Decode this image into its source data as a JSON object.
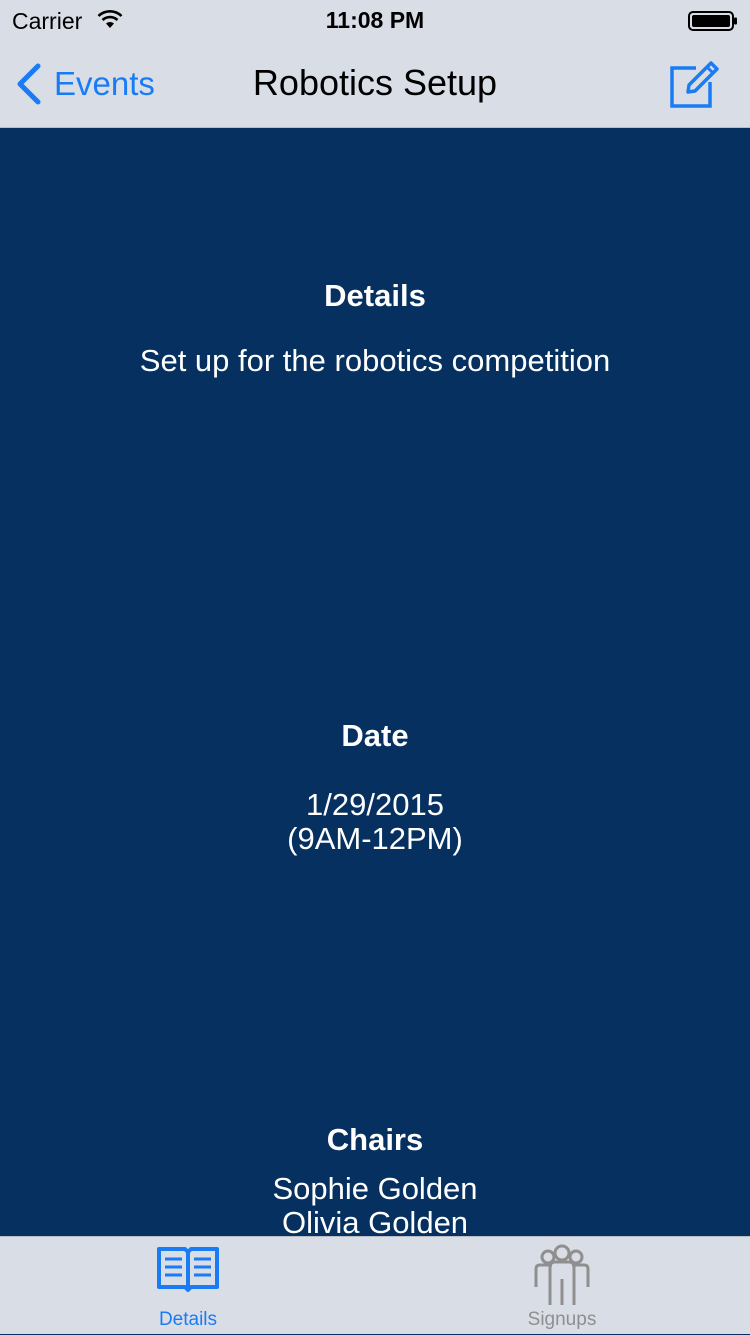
{
  "status_bar": {
    "carrier": "Carrier",
    "time": "11:08 PM"
  },
  "nav_bar": {
    "back_label": "Events",
    "title": "Robotics Setup",
    "accent_color": "#1a7cf5",
    "right_icon": "compose-icon"
  },
  "details": {
    "heading": "Details",
    "text": "Set up for the robotics competition"
  },
  "date": {
    "heading": "Date",
    "line1": "1/29/2015",
    "line2": "(9AM-12PM)"
  },
  "chairs": {
    "heading": "Chairs",
    "names": [
      "Sophie Golden",
      "Olivia Golden"
    ]
  },
  "tab_bar": {
    "tabs": [
      {
        "label": "Details",
        "icon": "book-icon",
        "selected": true
      },
      {
        "label": "Signups",
        "icon": "people-icon",
        "selected": false
      }
    ]
  },
  "colors": {
    "background": "#06305f",
    "bar_background": "#d9dde5",
    "inactive_tab": "#8f8f8f"
  }
}
